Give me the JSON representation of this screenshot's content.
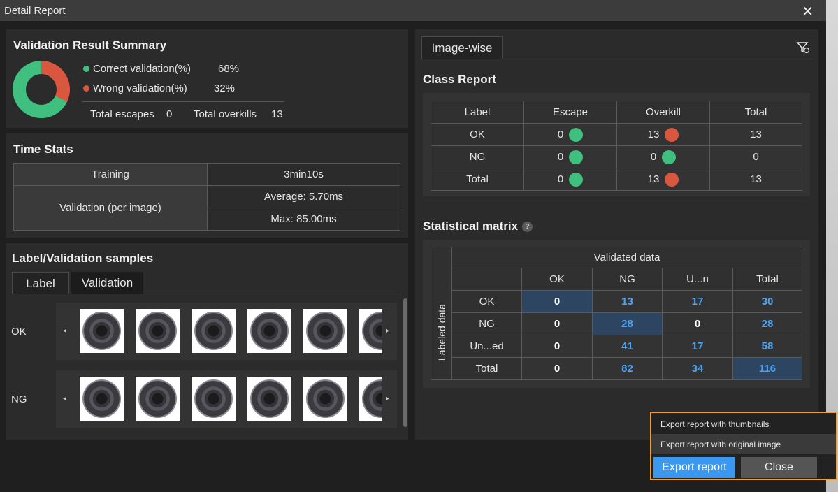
{
  "window": {
    "title": "Detail Report",
    "close_glyph": "✕"
  },
  "summary": {
    "title": "Validation Result Summary",
    "correct_label": "Correct validation(%)",
    "correct_value": "68%",
    "wrong_label": "Wrong validation(%)",
    "wrong_value": "32%",
    "correct_fraction": 0.68,
    "wrong_fraction": 0.32,
    "escapes_label": "Total escapes",
    "escapes_value": "0",
    "overkills_label": "Total overkills",
    "overkills_value": "13",
    "colors": {
      "correct": "#3fc07f",
      "wrong": "#d9573f"
    }
  },
  "time_stats": {
    "title": "Time Stats",
    "training_label": "Training",
    "training_value": "3min10s",
    "validation_label": "Validation (per image)",
    "average": "Average: 5.70ms",
    "max": "Max: 85.00ms"
  },
  "samples": {
    "title": "Label/Validation samples",
    "tabs": [
      "Label",
      "Validation"
    ],
    "rows": [
      "OK",
      "NG"
    ],
    "left_arrow": "◂",
    "right_arrow": "▸"
  },
  "right_panel": {
    "tab": "Image-wise",
    "filter_icon": "filter-settings-icon"
  },
  "class_report": {
    "title": "Class Report",
    "headers": [
      "Label",
      "Escape",
      "Overkill",
      "Total"
    ],
    "rows": [
      {
        "label": "OK",
        "escape": "0",
        "escape_color": "#3fc07f",
        "overkill": "13",
        "overkill_color": "#d9573f",
        "total": "13"
      },
      {
        "label": "NG",
        "escape": "0",
        "escape_color": "#3fc07f",
        "overkill": "0",
        "overkill_color": "#3fc07f",
        "total": "0"
      },
      {
        "label": "Total",
        "escape": "0",
        "escape_color": "#3fc07f",
        "overkill": "13",
        "overkill_color": "#d9573f",
        "total": "13"
      }
    ]
  },
  "matrix": {
    "title": "Statistical matrix",
    "help": "?",
    "validated_label": "Validated data",
    "labeled_label": "Labeled data",
    "columns": [
      "OK",
      "NG",
      "U...n",
      "Total"
    ],
    "rows": [
      {
        "label": "OK",
        "values": [
          "0",
          "13",
          "17",
          "30"
        ]
      },
      {
        "label": "NG",
        "values": [
          "0",
          "28",
          "0",
          "28"
        ]
      },
      {
        "label": "Un...ed",
        "values": [
          "0",
          "41",
          "17",
          "58"
        ]
      },
      {
        "label": "Total",
        "values": [
          "0",
          "82",
          "34",
          "116"
        ]
      }
    ]
  },
  "export_menu": {
    "thumbnails": "Export report with thumbnails",
    "original": "Export report with original image",
    "export_button": "Export report",
    "close_button": "Close",
    "highlight_color": "#f0a030"
  }
}
